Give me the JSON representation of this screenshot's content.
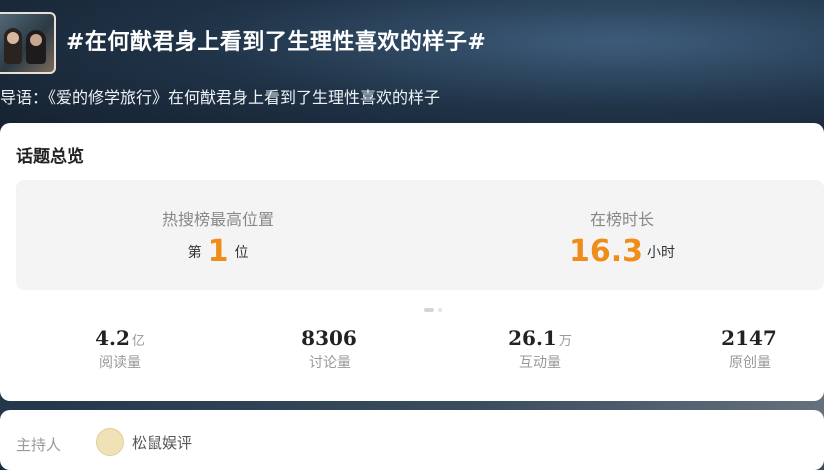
{
  "header": {
    "topic_title": "#在何猷君身上看到了生理性喜欢的样子#",
    "intro": "导语：《爱的修学旅行》在何猷君身上看到了生理性喜欢的样子"
  },
  "overview": {
    "title": "话题总览",
    "rank": {
      "label": "热搜榜最高位置",
      "prefix": "第",
      "value": "1",
      "suffix": "位"
    },
    "duration": {
      "label": "在榜时长",
      "value": "16.3",
      "unit": "小时"
    },
    "stats": [
      {
        "value": "4.2",
        "unit": "亿",
        "label": "阅读量"
      },
      {
        "value": "8306",
        "unit": "",
        "label": "讨论量"
      },
      {
        "value": "26.1",
        "unit": "万",
        "label": "互动量"
      },
      {
        "value": "2147",
        "unit": "",
        "label": "原创量"
      }
    ]
  },
  "host": {
    "label": "主持人",
    "name": "松鼠娱评"
  },
  "colors": {
    "accent": "#f08c1a",
    "card_bg": "#ffffff",
    "panel_bg": "#f4f4f5"
  }
}
